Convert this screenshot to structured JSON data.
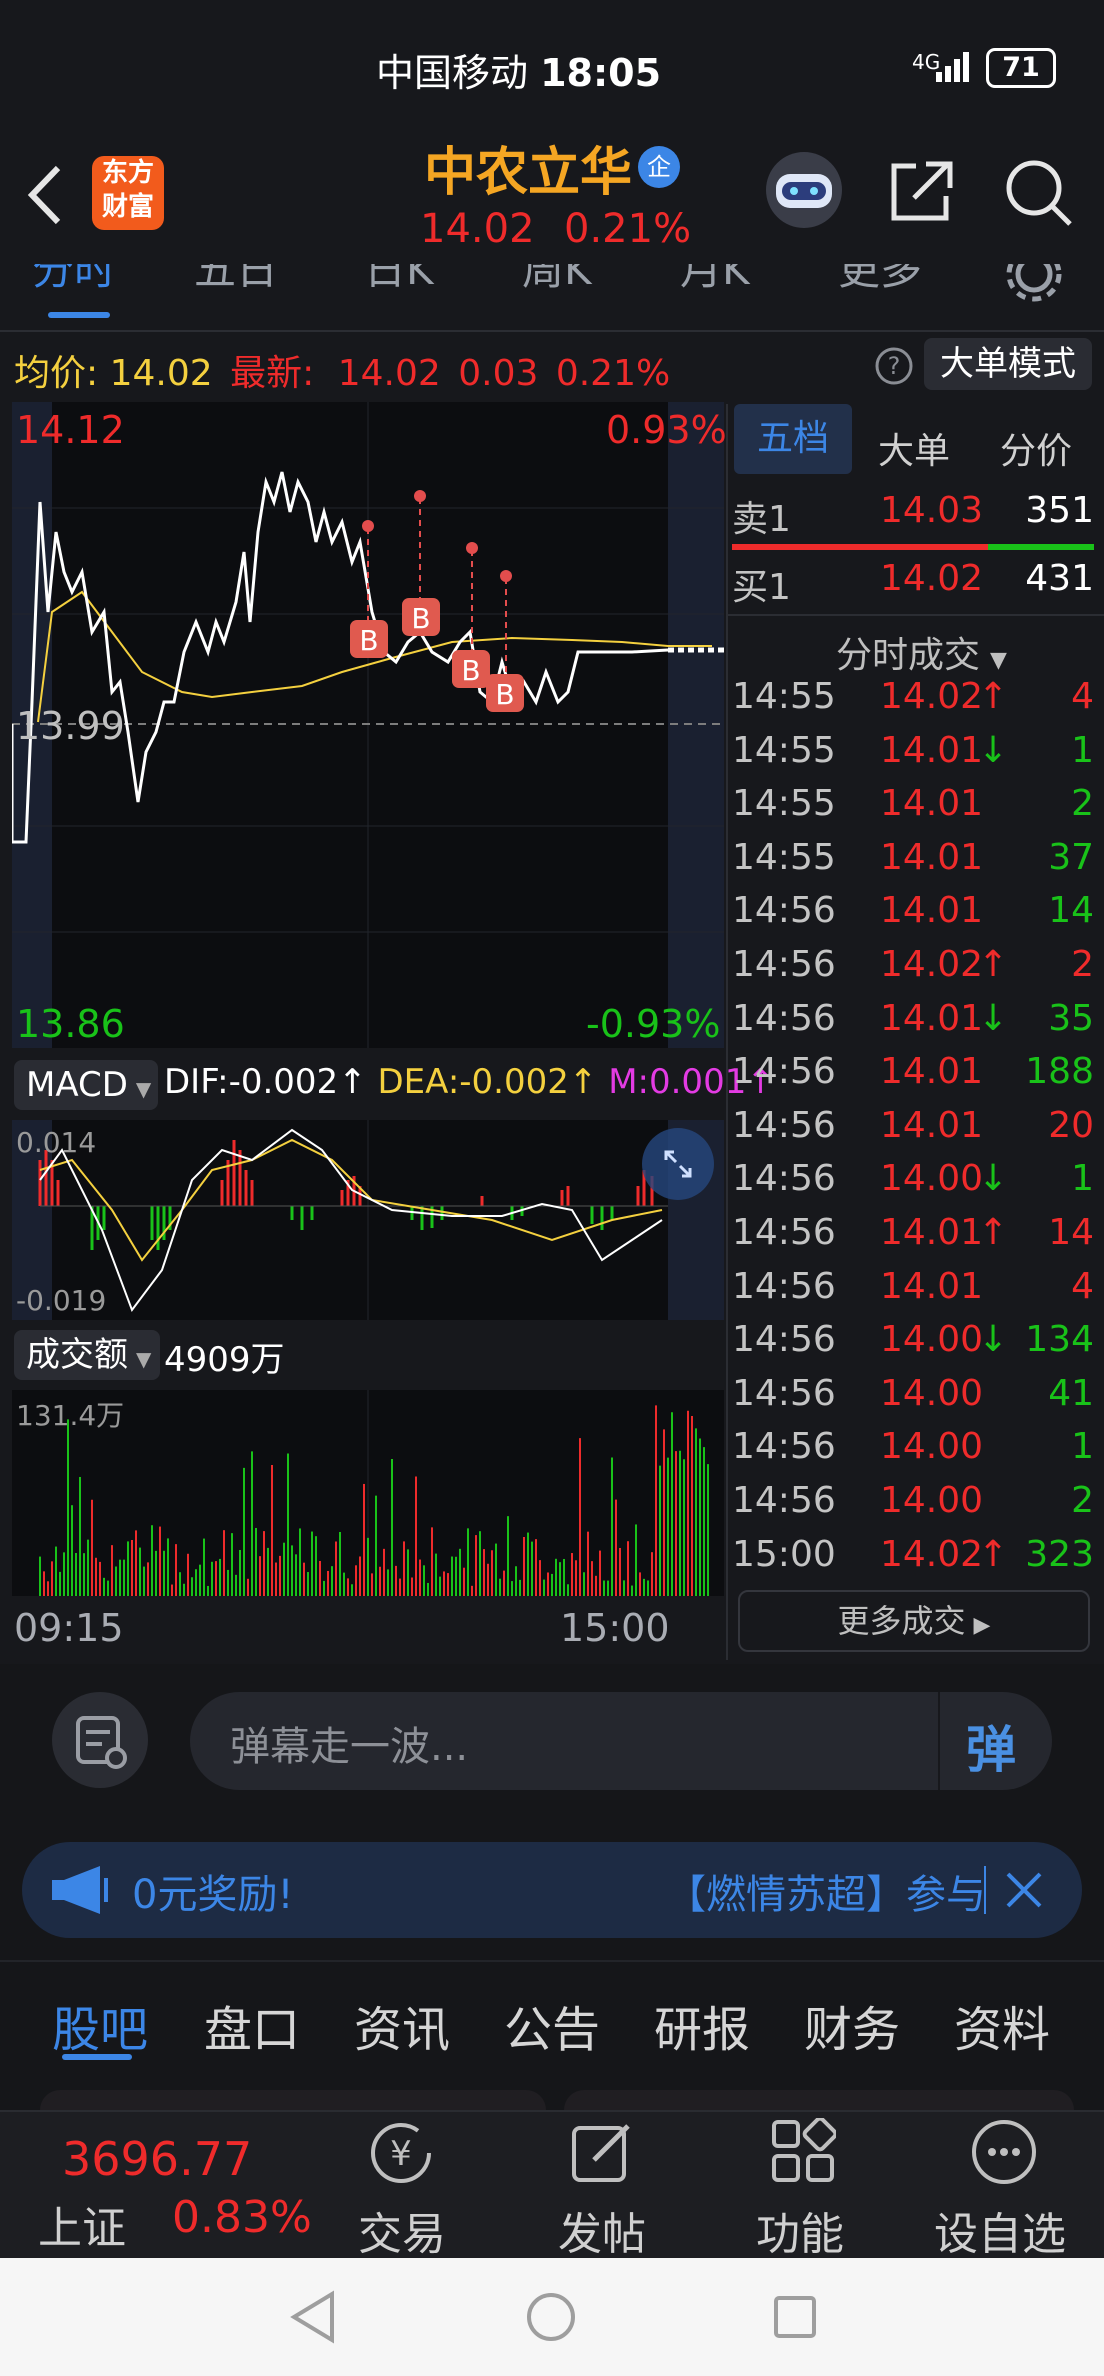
{
  "status": {
    "carrier": "中国移动",
    "time": "18:05",
    "network": "4G",
    "battery": "71"
  },
  "header": {
    "stock_name": "中农立华",
    "badge": "企",
    "price": "14.02",
    "change_pct": "0.21%",
    "logo_line1": "东方",
    "logo_line2": "财富"
  },
  "chart_tabs": [
    "分时",
    "五日",
    "日K",
    "周K",
    "月K",
    "更多"
  ],
  "info_bar": {
    "avg_label": "均价:",
    "avg_value": "14.02",
    "latest_label": "最新:",
    "latest_value": "14.02",
    "change": "0.03",
    "change_pct": "0.21%",
    "big_order_mode": "大单模式"
  },
  "intraday": {
    "top_price": "14.12",
    "top_pct": "0.93%",
    "mid_price": "13.99",
    "bottom_price": "13.86",
    "bottom_pct": "-0.93%",
    "start_time": "09:15",
    "end_time": "15:00",
    "marker_label": "B"
  },
  "macd": {
    "label": "MACD",
    "dif": "DIF:-0.002",
    "dea": "DEA:-0.002",
    "m": "M:0.001",
    "top": "0.014",
    "bottom": "-0.019"
  },
  "volume": {
    "label": "成交额",
    "value": "4909万",
    "max": "131.4万"
  },
  "order_book": {
    "tabs": [
      "五档",
      "大单",
      "分价"
    ],
    "sell": {
      "label": "卖1",
      "price": "14.03",
      "qty": "351"
    },
    "buy": {
      "label": "买1",
      "price": "14.02",
      "qty": "431"
    },
    "trades_title": "分时成交",
    "more_trades": "更多成交",
    "trades": [
      {
        "time": "14:55",
        "price": "14.02",
        "arrow": "↑",
        "qty": "4",
        "color": "red"
      },
      {
        "time": "14:55",
        "price": "14.01",
        "arrow": "↓",
        "qty": "1",
        "color": "green"
      },
      {
        "time": "14:55",
        "price": "14.01",
        "arrow": "",
        "qty": "2",
        "color": "green"
      },
      {
        "time": "14:55",
        "price": "14.01",
        "arrow": "",
        "qty": "37",
        "color": "green"
      },
      {
        "time": "14:56",
        "price": "14.01",
        "arrow": "",
        "qty": "14",
        "color": "green"
      },
      {
        "time": "14:56",
        "price": "14.02",
        "arrow": "↑",
        "qty": "2",
        "color": "red"
      },
      {
        "time": "14:56",
        "price": "14.01",
        "arrow": "↓",
        "qty": "35",
        "color": "green"
      },
      {
        "time": "14:56",
        "price": "14.01",
        "arrow": "",
        "qty": "188",
        "color": "green"
      },
      {
        "time": "14:56",
        "price": "14.01",
        "arrow": "",
        "qty": "20",
        "color": "red"
      },
      {
        "time": "14:56",
        "price": "14.00",
        "arrow": "↓",
        "qty": "1",
        "color": "green"
      },
      {
        "time": "14:56",
        "price": "14.01",
        "arrow": "↑",
        "qty": "14",
        "color": "red"
      },
      {
        "time": "14:56",
        "price": "14.01",
        "arrow": "",
        "qty": "4",
        "color": "red"
      },
      {
        "time": "14:56",
        "price": "14.00",
        "arrow": "↓",
        "qty": "134",
        "color": "green"
      },
      {
        "time": "14:56",
        "price": "14.00",
        "arrow": "",
        "qty": "41",
        "color": "green"
      },
      {
        "time": "14:56",
        "price": "14.00",
        "arrow": "",
        "qty": "1",
        "color": "green"
      },
      {
        "time": "14:56",
        "price": "14.00",
        "arrow": "",
        "qty": "2",
        "color": "green"
      },
      {
        "time": "15:00",
        "price": "14.02",
        "arrow": "↑",
        "qty": "323",
        "color": "green"
      }
    ]
  },
  "danmaku": {
    "placeholder": "弹幕走一波...",
    "button": "弹"
  },
  "notice": {
    "text_left": "0元奖励!",
    "text_right": "【燃情苏超】参与"
  },
  "bottom_tabs": [
    "股吧",
    "盘口",
    "资讯",
    "公告",
    "研报",
    "财务",
    "资料"
  ],
  "index": {
    "value": "3696.77",
    "name": "上证",
    "pct": "0.83%"
  },
  "bottom_nav": [
    "交易",
    "发帖",
    "功能",
    "设自选"
  ],
  "colors": {
    "up": "#ef2b2b",
    "down": "#19c219",
    "accent": "#3c86e6",
    "avg": "#f4d03f",
    "name": "#f5a623"
  }
}
